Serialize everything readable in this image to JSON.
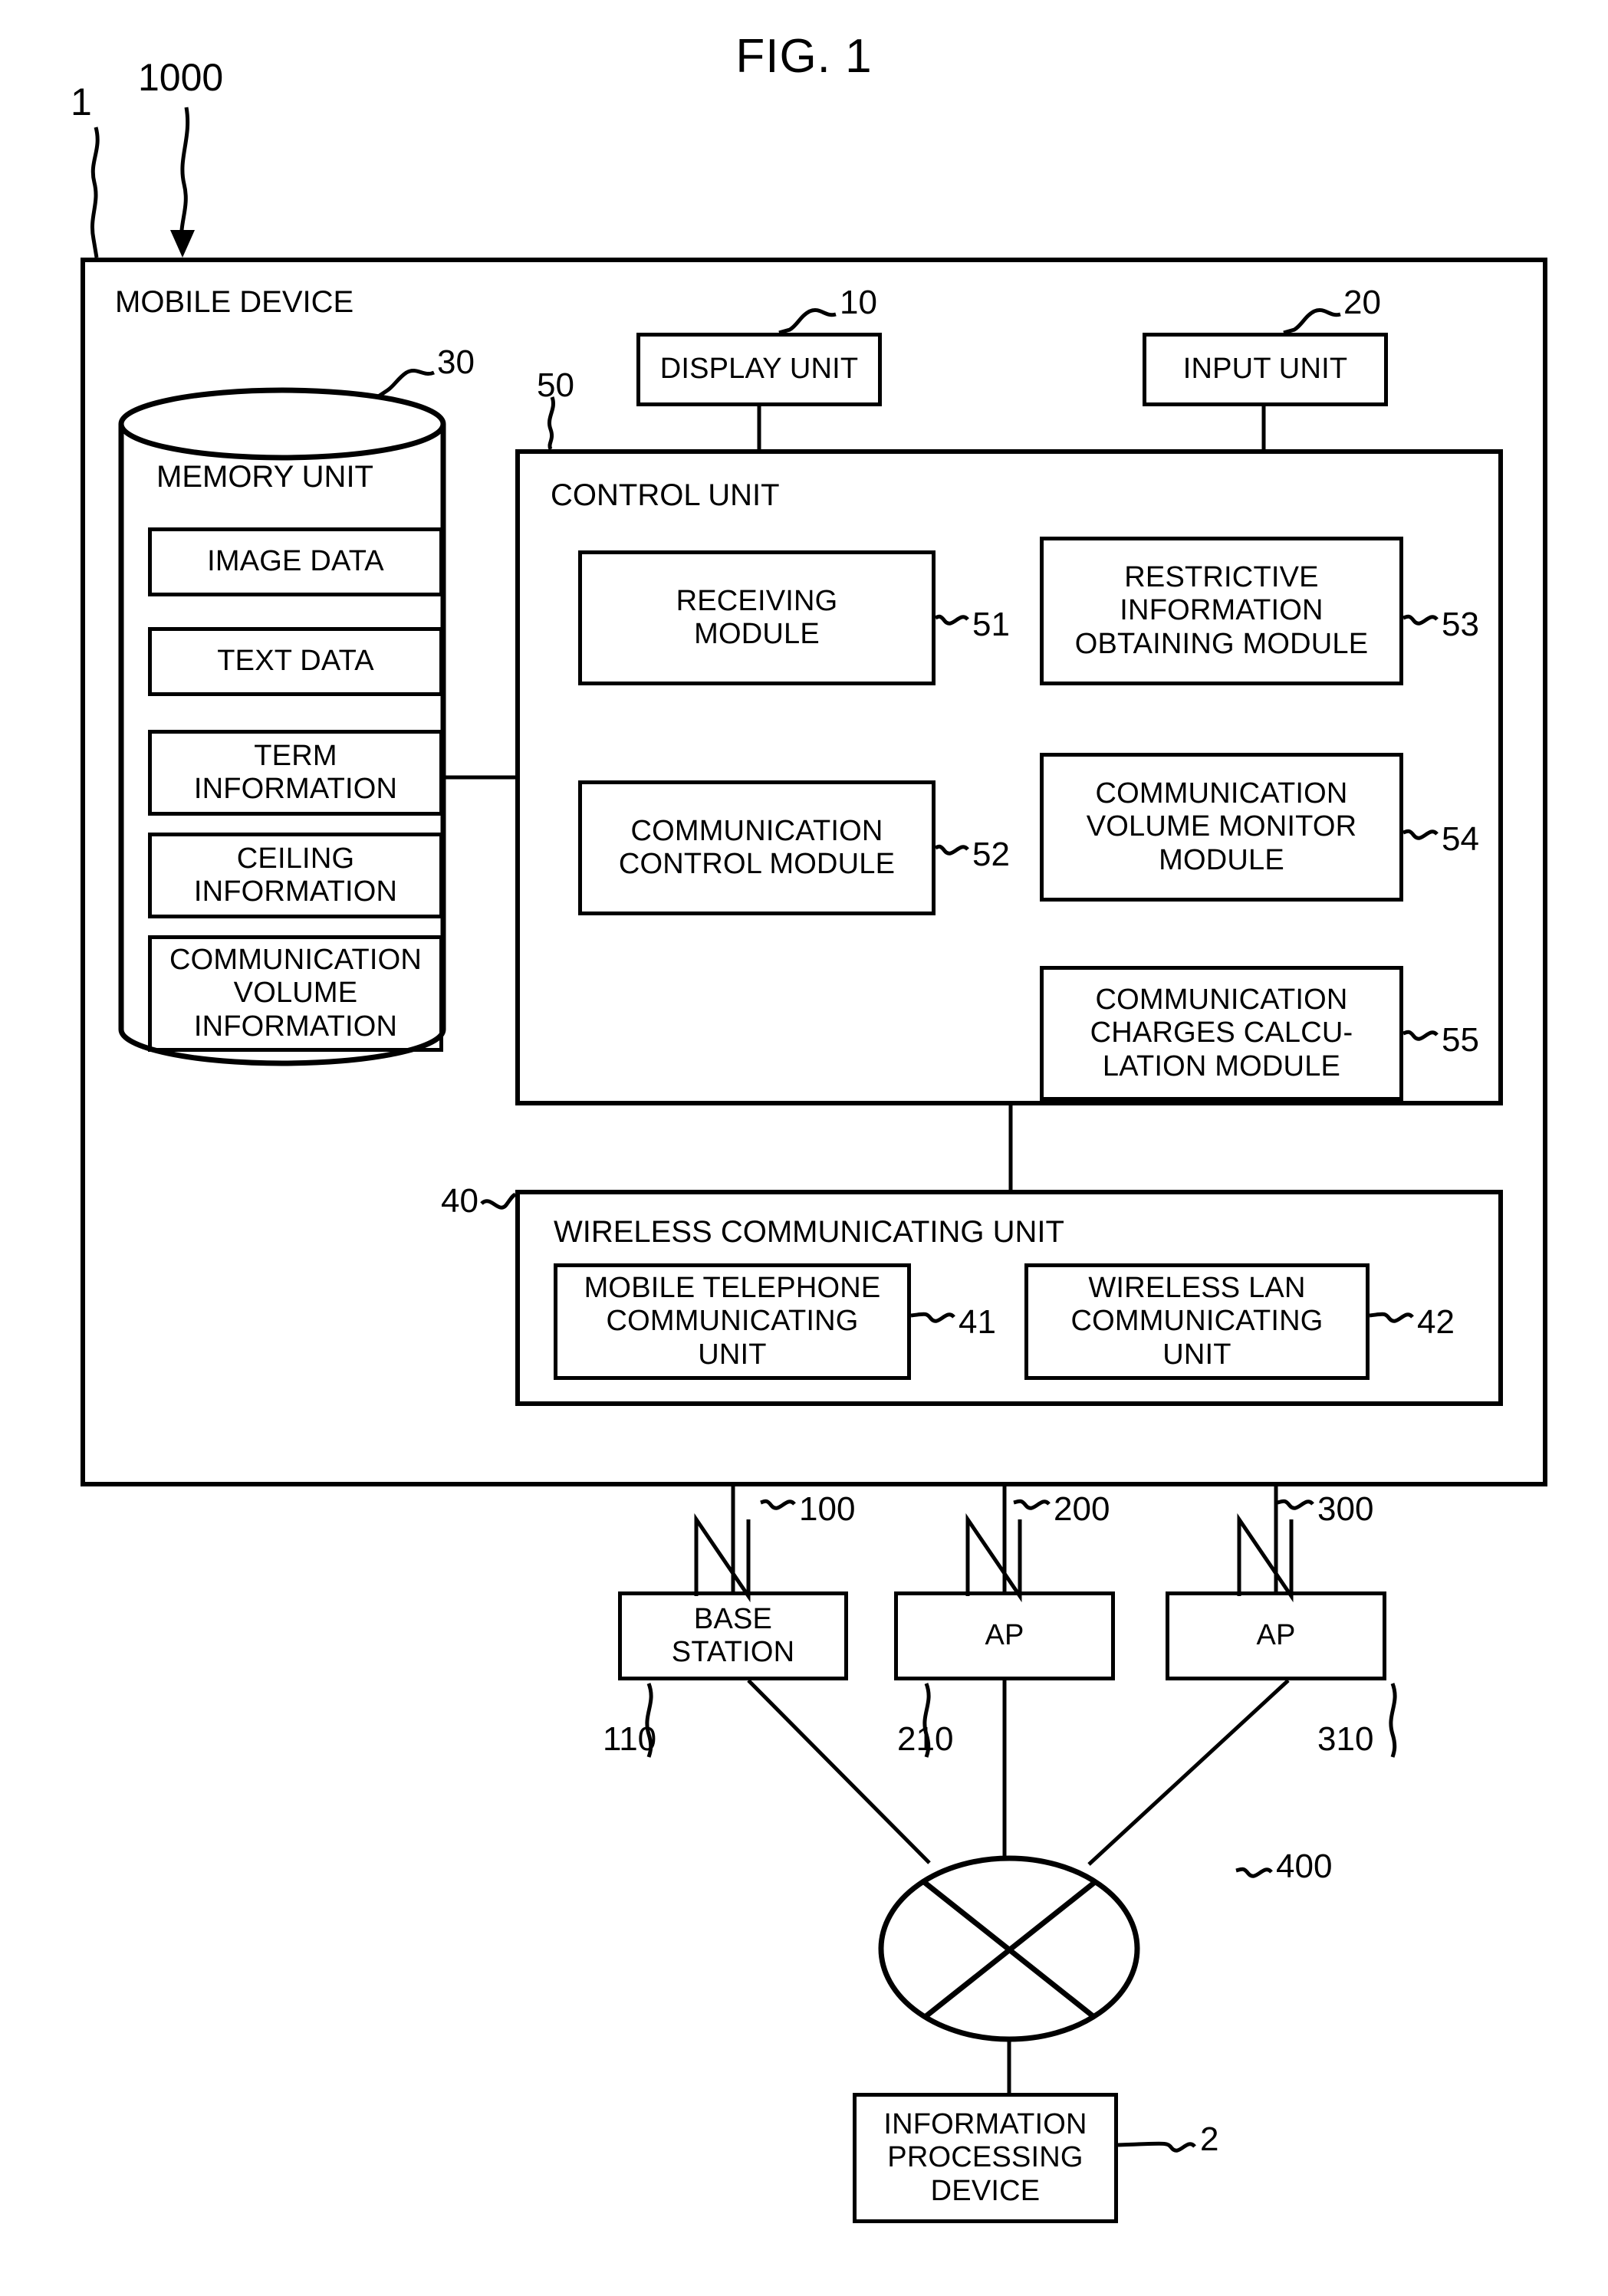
{
  "figure": {
    "title": "FIG. 1",
    "system_ref": "1000",
    "device_ref": "1"
  },
  "mobile_device": {
    "label": "MOBILE DEVICE",
    "ref": "1"
  },
  "display_unit": {
    "label": "DISPLAY UNIT",
    "ref": "10"
  },
  "input_unit": {
    "label": "INPUT UNIT",
    "ref": "20"
  },
  "memory_unit": {
    "label": "MEMORY UNIT",
    "ref": "30",
    "items": [
      {
        "label": "IMAGE DATA"
      },
      {
        "label": "TEXT DATA"
      },
      {
        "label": "TERM\nINFORMATION"
      },
      {
        "label": "CEILING\nINFORMATION"
      },
      {
        "label": "COMMUNICATION\nVOLUME\nINFORMATION"
      }
    ]
  },
  "control_unit": {
    "label": "CONTROL UNIT",
    "ref": "50",
    "modules": [
      {
        "label": "RECEIVING\nMODULE",
        "ref": "51"
      },
      {
        "label": "COMMUNICATION\nCONTROL MODULE",
        "ref": "52"
      },
      {
        "label": "RESTRICTIVE\nINFORMATION\nOBTAINING MODULE",
        "ref": "53"
      },
      {
        "label": "COMMUNICATION\nVOLUME MONITOR\nMODULE",
        "ref": "54"
      },
      {
        "label": "COMMUNICATION\nCHARGES CALCU-\nLATION MODULE",
        "ref": "55"
      }
    ]
  },
  "wireless_unit": {
    "label": "WIRELESS COMMUNICATING UNIT",
    "ref": "40",
    "modules": [
      {
        "label": "MOBILE TELEPHONE\nCOMMUNICATING\nUNIT",
        "ref": "41"
      },
      {
        "label": "WIRELESS LAN\nCOMMUNICATING\nUNIT",
        "ref": "42"
      }
    ]
  },
  "links": {
    "mobile_link_ref": "100",
    "ap1_link_ref": "200",
    "ap2_link_ref": "300"
  },
  "access_nodes": [
    {
      "label": "BASE\nSTATION",
      "ref": "110"
    },
    {
      "label": "AP",
      "ref": "210"
    },
    {
      "label": "AP",
      "ref": "310"
    }
  ],
  "network": {
    "ref": "400",
    "icon": "network-cloud-ellipse"
  },
  "server": {
    "label": "INFORMATION\nPROCESSING\nDEVICE",
    "ref": "2"
  }
}
